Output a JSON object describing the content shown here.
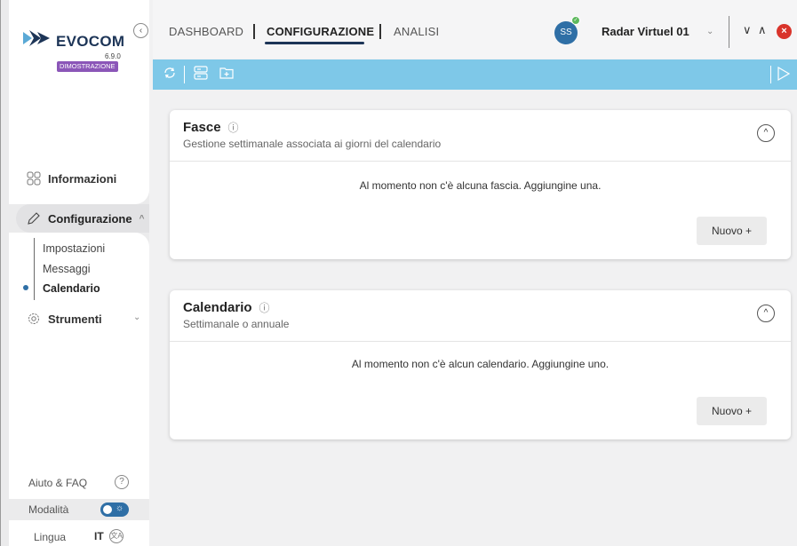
{
  "brand": {
    "name": "EVOCOM",
    "version": "6.9.0",
    "badge": "DIMOSTRAZIONE"
  },
  "sidebar": {
    "collapse_icon": "‹",
    "items": [
      {
        "label": "Informazioni",
        "icon": "grid-icon"
      },
      {
        "label": "Configurazione",
        "icon": "pencil-icon",
        "expanded": true
      },
      {
        "label": "Strumenti",
        "icon": "gear-icon"
      }
    ],
    "subitems": [
      "Impostazioni",
      "Messaggi",
      "Calendario"
    ],
    "active_subitem": "Calendario",
    "footer": {
      "help_label": "Aiuto & FAQ",
      "mode_label": "Modalità",
      "language_label": "Lingua",
      "language_code": "IT"
    }
  },
  "header": {
    "tabs": [
      {
        "label": "DASHBOARD",
        "active": false
      },
      {
        "label": "CONFIGURAZIONE",
        "active": true
      },
      {
        "label": "ANALISI",
        "active": false
      }
    ],
    "avatar_initials": "SS",
    "device_name": "Radar Virtuel 01"
  },
  "toolbar": {
    "icons": [
      "sync-icon",
      "server-icon",
      "add-folder-icon",
      "send-icon"
    ],
    "color": "#7ec8e8"
  },
  "cards": [
    {
      "title": "Fasce",
      "subtitle": "Gestione settimanale associata ai giorni del calendario",
      "empty_text": "Al momento non c'è alcuna fascia. Aggiungine una.",
      "button_label": "Nuovo +"
    },
    {
      "title": "Calendario",
      "subtitle": "Settimanale o annuale",
      "empty_text": "Al momento non c'è alcun calendario. Aggiungine uno.",
      "button_label": "Nuovo +"
    }
  ],
  "colors": {
    "accent": "#2f6fa6",
    "brand_navy": "#1d3557",
    "demo_badge": "#8b56b8",
    "close": "#d9342b"
  }
}
